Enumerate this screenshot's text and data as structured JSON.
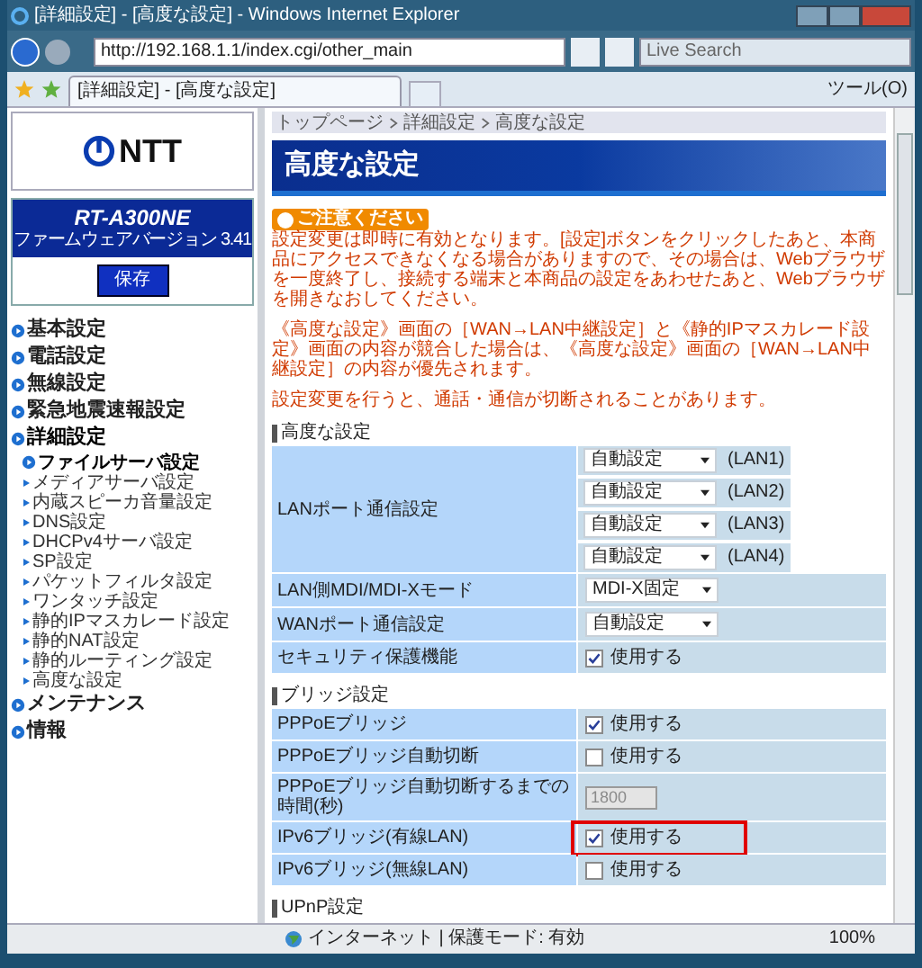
{
  "window": {
    "title": "[詳細設定] - [高度な設定] - Windows Internet Explorer",
    "address": "http://192.168.1.1/index.cgi/other_main",
    "search_placeholder": "Live Search",
    "tab_title": "[詳細設定] - [高度な設定]",
    "tools": "ツール(O)"
  },
  "sidebar": {
    "logo": "NTT",
    "model": "RT-A300NE",
    "firmware": "ファームウェアバージョン 3.41",
    "save": "保存",
    "menu": [
      {
        "label": "基本設定",
        "expanded": false
      },
      {
        "label": "電話設定",
        "expanded": false
      },
      {
        "label": "無線設定",
        "expanded": false
      },
      {
        "label": "緊急地震速報設定",
        "expanded": false
      },
      {
        "label": "詳細設定",
        "expanded": true,
        "children": [
          {
            "label": "ファイルサーバ設定",
            "selected": true
          },
          {
            "label": "メディアサーバ設定",
            "selected": false
          },
          {
            "label": "内蔵スピーカ音量設定",
            "selected": false
          },
          {
            "label": "DNS設定",
            "selected": false
          },
          {
            "label": "DHCPv4サーバ設定",
            "selected": false
          },
          {
            "label": "SP設定",
            "selected": false
          },
          {
            "label": "パケットフィルタ設定",
            "selected": false
          },
          {
            "label": "ワンタッチ設定",
            "selected": false
          },
          {
            "label": "静的IPマスカレード設定",
            "selected": false
          },
          {
            "label": "静的NAT設定",
            "selected": false
          },
          {
            "label": "静的ルーティング設定",
            "selected": false
          },
          {
            "label": "高度な設定",
            "selected": false
          }
        ]
      },
      {
        "label": "メンテナンス",
        "expanded": false
      },
      {
        "label": "情報",
        "expanded": false
      }
    ]
  },
  "breadcrumb": [
    "トップページ",
    "詳細設定",
    "高度な設定"
  ],
  "page_title": "高度な設定",
  "notice": {
    "badge": "ご注意ください",
    "paragraphs": [
      "設定変更は即時に有効となります。[設定]ボタンをクリックしたあと、本商品にアクセスできなくなる場合がありますので、その場合は、Webブラウザを一度終了し、接続する端末と本商品の設定をあわせたあと、Webブラウザを開きなおしてください。",
      "《高度な設定》画面の［WAN→LAN中継設定］と《静的IPマスカレード設定》画面の内容が競合した場合は、《高度な設定》画面の［WAN→LAN中継設定］の内容が優先されます。",
      "設定変更を行うと、通話・通信が切断されることがあります。"
    ]
  },
  "sections": [
    {
      "heading": "高度な設定",
      "rows": [
        {
          "label": "LANポート通信設定",
          "kind": "selects",
          "selects": [
            {
              "value": "自動設定",
              "suffix": "(LAN1)"
            },
            {
              "value": "自動設定",
              "suffix": "(LAN2)"
            },
            {
              "value": "自動設定",
              "suffix": "(LAN3)"
            },
            {
              "value": "自動設定",
              "suffix": "(LAN4)"
            }
          ]
        },
        {
          "label": "LAN側MDI/MDI-Xモード",
          "kind": "select",
          "value": "MDI-X固定"
        },
        {
          "label": "WANポート通信設定",
          "kind": "select",
          "value": "自動設定"
        },
        {
          "label": "セキュリティ保護機能",
          "kind": "checkbox",
          "checked": true,
          "text": "使用する"
        }
      ]
    },
    {
      "heading": "ブリッジ設定",
      "rows": [
        {
          "label": "PPPoEブリッジ",
          "kind": "checkbox",
          "checked": true,
          "text": "使用する"
        },
        {
          "label": "PPPoEブリッジ自動切断",
          "kind": "checkbox",
          "checked": false,
          "text": "使用する"
        },
        {
          "label": "PPPoEブリッジ自動切断するまでの時間(秒)",
          "kind": "input",
          "value": "1800",
          "disabled": true
        },
        {
          "label": "IPv6ブリッジ(有線LAN)",
          "kind": "checkbox",
          "checked": true,
          "text": "使用する",
          "highlighted": true
        },
        {
          "label": "IPv6ブリッジ(無線LAN)",
          "kind": "checkbox",
          "checked": false,
          "text": "使用する"
        }
      ]
    },
    {
      "heading": "UPnP設定"
    }
  ],
  "status": {
    "zone": "インターネット | 保護モード: 有効",
    "zoom": "100%"
  }
}
